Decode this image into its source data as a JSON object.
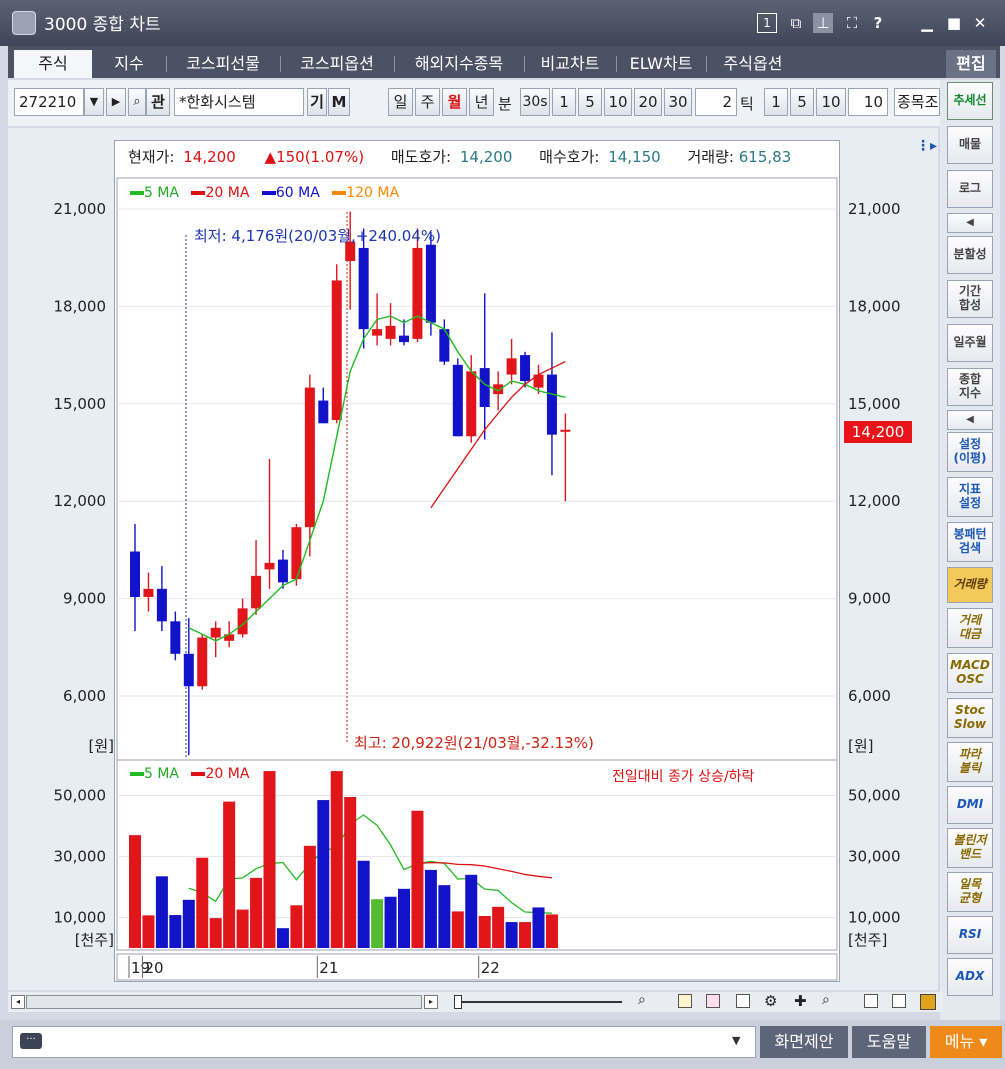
{
  "window": {
    "title": "3000 종합 차트",
    "edit_label": "편집"
  },
  "tabs": [
    "주식",
    "지수",
    "코스피선물",
    "코스피옵션",
    "해외지수종목",
    "비교차트",
    "ELW차트",
    "주식옵션"
  ],
  "toolbar": {
    "code": "272210",
    "name": "*한화시스템",
    "gwan": "관",
    "gi": "기",
    "m": "M",
    "periods": [
      "일",
      "주",
      "월",
      "년",
      "분"
    ],
    "active_period": "월",
    "minute_buttons": [
      "30s",
      "1",
      "5",
      "10",
      "20",
      "30"
    ],
    "minute_value": "2",
    "tick_label": "틱",
    "tick_buttons": [
      "1",
      "5",
      "10"
    ],
    "tick_value": "10",
    "compare_label": "종목조"
  },
  "info": {
    "price_label": "현재가:",
    "price": "14,200",
    "change": "▲150(1.07%)",
    "ask_label": "매도호가:",
    "ask": "14,200",
    "bid_label": "매수호가:",
    "bid": "14,150",
    "volume_label": "거래량:",
    "volume": "615,83"
  },
  "legend_price": [
    {
      "name": "5 MA",
      "color": "#22bb22"
    },
    {
      "name": "20 MA",
      "color": "#dd1111"
    },
    {
      "name": "60 MA",
      "color": "#1111cc"
    },
    {
      "name": "120 MA",
      "color": "#ff8800"
    }
  ],
  "legend_volume": [
    {
      "name": "5 MA",
      "color": "#22bb22"
    },
    {
      "name": "20 MA",
      "color": "#dd1111"
    }
  ],
  "annotations": {
    "low": "최저: 4,176원(20/03월,+240.04%)",
    "high": "최고: 20,922원(21/03월,-32.13%)",
    "volume_note": "전일대비 종가 상승/하락"
  },
  "price_badge": "14,200",
  "sidebar": [
    {
      "label": "추세선",
      "style": "green"
    },
    {
      "label": "매물",
      "style": ""
    },
    {
      "label": "로그",
      "style": ""
    },
    {
      "label": "◀",
      "style": ""
    },
    {
      "label": "분할성",
      "style": ""
    },
    {
      "label": "기간\n합성",
      "style": ""
    },
    {
      "label": "일주월",
      "style": ""
    },
    {
      "label": "종합\n지수",
      "style": ""
    },
    {
      "label": "◀",
      "style": ""
    },
    {
      "label": "설정\n(이평)",
      "style": "blue"
    },
    {
      "label": "지표\n설정",
      "style": "blue"
    },
    {
      "label": "봉패턴\n검색",
      "style": "blue"
    },
    {
      "label": "거래량",
      "style": "sel"
    },
    {
      "label": "거래\n대금",
      "style": "gold"
    },
    {
      "label": "MACD\nOSC",
      "style": "gold"
    },
    {
      "label": "Stoc\nSlow",
      "style": "gold"
    },
    {
      "label": "파라\n볼릭",
      "style": "gold"
    },
    {
      "label": "DMI",
      "style": "italic"
    },
    {
      "label": "볼린저\n밴드",
      "style": "gold"
    },
    {
      "label": "일목\n균형",
      "style": "gold"
    },
    {
      "label": "RSI",
      "style": "italic"
    },
    {
      "label": "ADX",
      "style": "italic"
    }
  ],
  "bottom": {
    "suggest": "화면제안",
    "help": "도움말",
    "menu": "메뉴 ▾"
  },
  "chart_data": {
    "type": "candlestick",
    "period": "monthly",
    "price_axis": {
      "ticks": [
        "21,000",
        "18,000",
        "15,000",
        "12,000",
        "9,000",
        "6,000"
      ],
      "unit": "[원]",
      "ylim": [
        4600,
        21500
      ]
    },
    "volume_axis": {
      "ticks": [
        "50,000",
        "30,000",
        "10,000"
      ],
      "unit": "[천주]",
      "ylim": [
        0,
        58000
      ]
    },
    "x_labels": [
      {
        "label": "19",
        "index": 0
      },
      {
        "label": "20",
        "index": 1
      },
      {
        "label": "21",
        "index": 14
      },
      {
        "label": "22",
        "index": 26
      }
    ],
    "candles": [
      {
        "o": 9050,
        "h": 11300,
        "l": 8000,
        "c": 10450,
        "up": false
      },
      {
        "o": 9050,
        "h": 9800,
        "l": 8600,
        "c": 9300,
        "up": true
      },
      {
        "o": 9300,
        "h": 10000,
        "l": 8000,
        "c": 8300,
        "up": false
      },
      {
        "o": 8300,
        "h": 8600,
        "l": 7100,
        "c": 7300,
        "up": false
      },
      {
        "o": 7300,
        "h": 8400,
        "l": 4176,
        "c": 6300,
        "up": false
      },
      {
        "o": 6300,
        "h": 7900,
        "l": 6200,
        "c": 7800,
        "up": true
      },
      {
        "o": 7800,
        "h": 8300,
        "l": 7200,
        "c": 8100,
        "up": true
      },
      {
        "o": 7700,
        "h": 8300,
        "l": 7500,
        "c": 7900,
        "up": true
      },
      {
        "o": 7900,
        "h": 9000,
        "l": 7800,
        "c": 8700,
        "up": true
      },
      {
        "o": 8700,
        "h": 10800,
        "l": 8500,
        "c": 9700,
        "up": true
      },
      {
        "o": 9900,
        "h": 13300,
        "l": 9300,
        "c": 10100,
        "up": true
      },
      {
        "o": 10200,
        "h": 10500,
        "l": 9300,
        "c": 9500,
        "up": false
      },
      {
        "o": 9600,
        "h": 11300,
        "l": 9400,
        "c": 11200,
        "up": true
      },
      {
        "o": 11200,
        "h": 15900,
        "l": 10300,
        "c": 15500,
        "up": true
      },
      {
        "o": 15100,
        "h": 15500,
        "l": 14400,
        "c": 14400,
        "up": false
      },
      {
        "o": 14500,
        "h": 19300,
        "l": 14400,
        "c": 18800,
        "up": true
      },
      {
        "o": 19400,
        "h": 20922,
        "l": 17900,
        "c": 20000,
        "up": true
      },
      {
        "o": 19800,
        "h": 20400,
        "l": 16700,
        "c": 17300,
        "up": false
      },
      {
        "o": 17300,
        "h": 18400,
        "l": 16800,
        "c": 17100,
        "up": true
      },
      {
        "o": 17000,
        "h": 18100,
        "l": 16800,
        "c": 17400,
        "up": true
      },
      {
        "o": 17100,
        "h": 17600,
        "l": 16800,
        "c": 16900,
        "up": false
      },
      {
        "o": 17000,
        "h": 20400,
        "l": 16900,
        "c": 19800,
        "up": true
      },
      {
        "o": 19900,
        "h": 20300,
        "l": 17100,
        "c": 17500,
        "up": false
      },
      {
        "o": 17300,
        "h": 17600,
        "l": 16200,
        "c": 16300,
        "up": false
      },
      {
        "o": 16200,
        "h": 16400,
        "l": 14000,
        "c": 14000,
        "up": false
      },
      {
        "o": 14000,
        "h": 16500,
        "l": 13800,
        "c": 16000,
        "up": true
      },
      {
        "o": 16100,
        "h": 18400,
        "l": 13900,
        "c": 14900,
        "up": false
      },
      {
        "o": 15300,
        "h": 16000,
        "l": 14800,
        "c": 15600,
        "up": true
      },
      {
        "o": 15900,
        "h": 17000,
        "l": 15600,
        "c": 16400,
        "up": true
      },
      {
        "o": 16500,
        "h": 16600,
        "l": 15500,
        "c": 15700,
        "up": false
      },
      {
        "o": 15500,
        "h": 16200,
        "l": 15300,
        "c": 15900,
        "up": true
      },
      {
        "o": 15900,
        "h": 17200,
        "l": 12800,
        "c": 14050,
        "up": false
      },
      {
        "o": 14150,
        "h": 14700,
        "l": 12000,
        "c": 14200,
        "up": true
      }
    ],
    "ma5": [
      null,
      null,
      null,
      null,
      8100,
      7900,
      7700,
      7900,
      8200,
      8600,
      9000,
      9400,
      9600,
      10800,
      12000,
      14000,
      16000,
      17000,
      17600,
      17700,
      17500,
      17700,
      17500,
      17300,
      16600,
      16000,
      15600,
      15400,
      15700,
      15600,
      15400,
      15300,
      15200
    ],
    "ma20": [
      null,
      null,
      null,
      null,
      null,
      null,
      null,
      null,
      null,
      null,
      null,
      null,
      null,
      null,
      null,
      null,
      null,
      null,
      null,
      null,
      null,
      null,
      11800,
      12400,
      13000,
      13600,
      14200,
      14700,
      15200,
      15600,
      15900,
      16100,
      16300
    ],
    "volume": [
      {
        "v": 37000,
        "up": true
      },
      {
        "v": 10700,
        "up": true
      },
      {
        "v": 23500,
        "up": false
      },
      {
        "v": 10800,
        "up": false
      },
      {
        "v": 15800,
        "up": false
      },
      {
        "v": 29600,
        "up": true
      },
      {
        "v": 9800,
        "up": true
      },
      {
        "v": 48000,
        "up": true
      },
      {
        "v": 12600,
        "up": true
      },
      {
        "v": 23000,
        "up": true
      },
      {
        "v": 58000,
        "up": true
      },
      {
        "v": 6500,
        "up": false
      },
      {
        "v": 14000,
        "up": true
      },
      {
        "v": 33500,
        "up": true
      },
      {
        "v": 48500,
        "up": false
      },
      {
        "v": 58000,
        "up": true
      },
      {
        "v": 49500,
        "up": true
      },
      {
        "v": 28600,
        "up": false
      },
      {
        "v": 16000,
        "up": "flat"
      },
      {
        "v": 16800,
        "up": false
      },
      {
        "v": 19400,
        "up": false
      },
      {
        "v": 45000,
        "up": true
      },
      {
        "v": 25600,
        "up": false
      },
      {
        "v": 20600,
        "up": false
      },
      {
        "v": 12000,
        "up": true
      },
      {
        "v": 24000,
        "up": false
      },
      {
        "v": 10500,
        "up": true
      },
      {
        "v": 13500,
        "up": true
      },
      {
        "v": 8500,
        "up": false
      },
      {
        "v": 8500,
        "up": true
      },
      {
        "v": 13300,
        "up": false
      },
      {
        "v": 11000,
        "up": true
      }
    ],
    "vol_ma5": [
      null,
      null,
      null,
      null,
      19600,
      18100,
      15300,
      22600,
      23000,
      26000,
      27700,
      28000,
      22400,
      27600,
      31900,
      32900,
      40700,
      43600,
      40200,
      33800,
      25700,
      27600,
      28400,
      27700,
      22600,
      22800,
      19300,
      18900,
      14900,
      11800,
      11600,
      11400
    ],
    "vol_ma20": [
      null,
      null,
      null,
      null,
      null,
      null,
      null,
      null,
      null,
      null,
      null,
      null,
      null,
      null,
      null,
      null,
      null,
      null,
      null,
      null,
      null,
      27700,
      28000,
      27900,
      27400,
      27300,
      26900,
      26000,
      25100,
      24100,
      23500,
      23000
    ]
  }
}
